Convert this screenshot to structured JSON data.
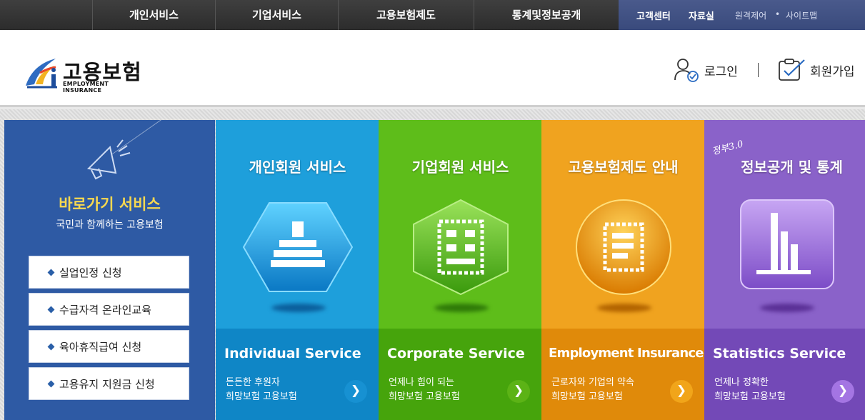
{
  "topnav": {
    "items": [
      "개인서비스",
      "기업서비스",
      "고용보험제도",
      "통계및정보공개"
    ],
    "util": {
      "customer_center": "고객센터",
      "data_room": "자료실",
      "remote": "원격제어",
      "sitemap": "사이트맵"
    }
  },
  "header": {
    "logo_title": "고용보험",
    "logo_sub": "EMPLOYMENT INSURANCE",
    "login": "로그인",
    "join": "회원가입"
  },
  "quick": {
    "title": "바로가기 서비스",
    "subtitle": "국민과 함께하는 고용보험",
    "buttons": [
      "실업인정 신청",
      "수급자격 온라인교육",
      "육아휴직급여 신청",
      "고용유지 지원금 신청"
    ]
  },
  "panels": [
    {
      "title": "개인회원 서비스",
      "en": "Individual Service",
      "desc1": "든든한 후원자",
      "desc2": "희망보험 고용보험",
      "arrow": "❯",
      "color": "#1e9fdb",
      "bottom_color": "#0f86c6",
      "arrow_bg": "#1791d2",
      "icon": "person-icon"
    },
    {
      "title": "기업회원 서비스",
      "en": "Corporate Service",
      "desc1": "언제나 힘이 되는",
      "desc2": "희망보험 고용보험",
      "arrow": "❯",
      "color": "#5ebd1a",
      "bottom_color": "#46a40c",
      "arrow_bg": "#5cb316",
      "icon": "building-icon"
    },
    {
      "title": "고용보험제도 안내",
      "en": "Employment Insurance",
      "desc1": "근로자와 기업의 약속",
      "desc2": "희망보험 고용보험",
      "arrow": "❯",
      "color": "#f0a31f",
      "bottom_color": "#e08a0a",
      "arrow_bg": "#f1a51a",
      "icon": "document-icon"
    },
    {
      "title": "정보공개 및 통계",
      "en": "Statistics Service",
      "desc1": "언제나 정확한",
      "desc2": "희망보험 고용보험",
      "arrow": "❯",
      "color": "#8a62c9",
      "bottom_color": "#7349b7",
      "arrow_bg": "#a475e3",
      "icon": "bar-chart-icon",
      "badge": "정부3.0"
    }
  ]
}
